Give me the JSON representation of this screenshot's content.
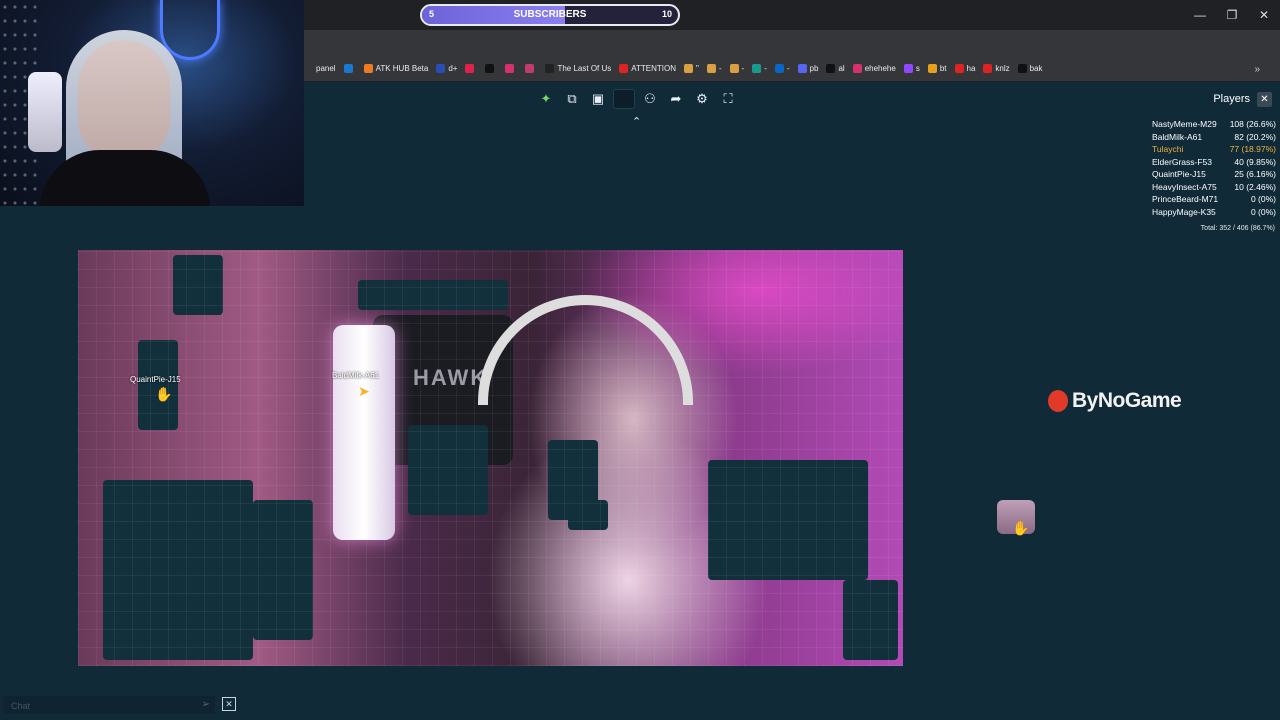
{
  "browser": {
    "url_fragment": "c9eef68",
    "bookmarks": [
      {
        "label": "panel",
        "color": "#35363a"
      },
      {
        "label": "",
        "color": "#1b78d0"
      },
      {
        "label": "ATK HUB Beta",
        "color": "#f07a20"
      },
      {
        "label": "d+",
        "color": "#2a4cb5"
      },
      {
        "label": "",
        "color": "#e0224a"
      },
      {
        "label": "",
        "color": "#111111"
      },
      {
        "label": "",
        "color": "#d6316e"
      },
      {
        "label": "",
        "color": "#c23b6a"
      },
      {
        "label": "The Last Of Us",
        "color": "#222222"
      },
      {
        "label": "ATTENTION",
        "color": "#e02222"
      },
      {
        "label": "\"",
        "color": "#d8a040"
      },
      {
        "label": "-",
        "color": "#d8a040"
      },
      {
        "label": "-",
        "color": "#d8a040"
      },
      {
        "label": "-",
        "color": "#1a9a8a"
      },
      {
        "label": "-",
        "color": "#0a66c2"
      },
      {
        "label": "pb",
        "color": "#5865f2"
      },
      {
        "label": "al",
        "color": "#111111"
      },
      {
        "label": "ehehehe",
        "color": "#d6316e"
      },
      {
        "label": "s",
        "color": "#9146ff"
      },
      {
        "label": "bt",
        "color": "#e8a020"
      },
      {
        "label": "ha",
        "color": "#e02222"
      },
      {
        "label": "knlz",
        "color": "#e02222"
      },
      {
        "label": "bak",
        "color": "#111111"
      }
    ],
    "more": "»"
  },
  "subscribers": {
    "start": "5",
    "label": "SUBSCRIBERS",
    "end": "10",
    "progress": 0.56
  },
  "toolbar": {
    "tools": [
      {
        "name": "puzzle-logo-icon",
        "glyph": "✦"
      },
      {
        "name": "puzzle-piece-icon",
        "glyph": "⧉"
      },
      {
        "name": "image-preview-icon",
        "glyph": "▣"
      },
      {
        "name": "blank-tool-icon",
        "glyph": ""
      },
      {
        "name": "players-icon",
        "glyph": "⚇"
      },
      {
        "name": "share-icon",
        "glyph": "➦"
      },
      {
        "name": "settings-icon",
        "glyph": "⚙"
      },
      {
        "name": "fullscreen-icon",
        "glyph": "⛶"
      }
    ],
    "collapse": "⌃"
  },
  "players": {
    "title": "Players",
    "close": "✕",
    "list": [
      {
        "name": "NastyMeme-M29",
        "score": "108 (26.6%)",
        "highlight": false
      },
      {
        "name": "BaldMilk-A61",
        "score": "82 (20.2%)",
        "highlight": false
      },
      {
        "name": "Tulaychi",
        "score": "77 (18.97%)",
        "highlight": true
      },
      {
        "name": "ElderGrass-F53",
        "score": "40 (9.85%)",
        "highlight": false
      },
      {
        "name": "QuaintPie-J15",
        "score": "25 (6.16%)",
        "highlight": false
      },
      {
        "name": "HeavyInsect-A75",
        "score": "10 (2.46%)",
        "highlight": false
      },
      {
        "name": "PrinceBeard-M71",
        "score": "0 (0%)",
        "highlight": false
      },
      {
        "name": "HappyMage-K35",
        "score": "0 (0%)",
        "highlight": false
      }
    ],
    "total": "Total: 352 / 406 (86.7%)"
  },
  "puzzle": {
    "cursors": [
      {
        "label": "QuaintPie-J15"
      },
      {
        "label": "BaldMilk-A61"
      }
    ],
    "hawk": "HAWK"
  },
  "logo": {
    "text": "ByNoGame"
  },
  "chat": {
    "placeholder": "Chat",
    "send": "➢",
    "close": "✕"
  }
}
